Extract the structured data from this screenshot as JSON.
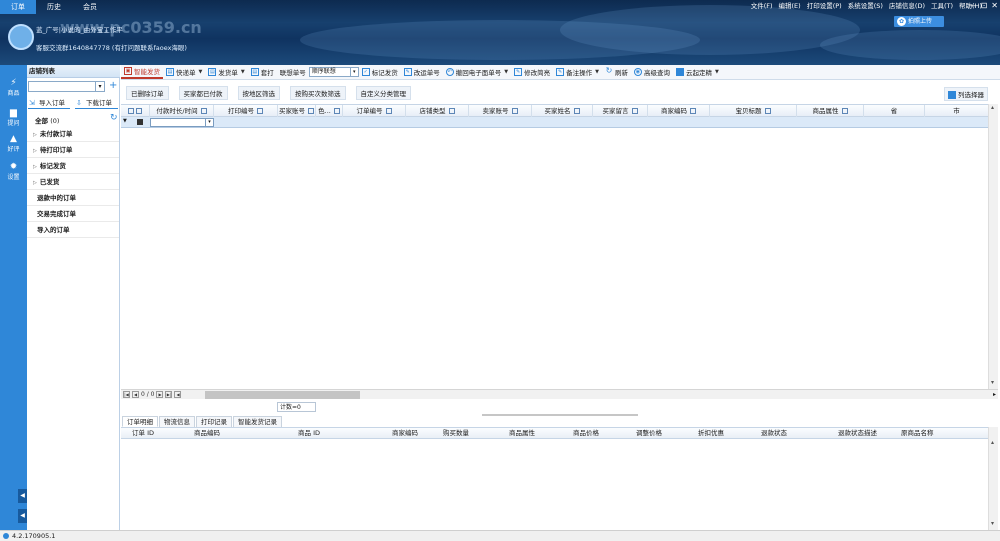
{
  "topnav": {
    "tabs": [
      "订单",
      "历史",
      "会员"
    ],
    "active": 0
  },
  "menubar": {
    "items": [
      "文件(F)",
      "编辑(E)",
      "打印设置(P)",
      "系统设置(S)",
      "店铺信息(D)",
      "工具(T)",
      "帮助(H)"
    ]
  },
  "window_controls": [
    "—",
    "⊡",
    "✕"
  ],
  "header": {
    "shop_line": "蓝_广号|小说的_由外宝工作平",
    "hotline": "客服交流群1640847778 (有打问题联系faoex海眼)",
    "upload_label": "拍照上传",
    "watermark": "www.pc0359.cn"
  },
  "left_strip": {
    "items": [
      {
        "icon": "share-icon",
        "label": "商品"
      },
      {
        "icon": "chat-icon",
        "label": "提问"
      },
      {
        "icon": "thumb-icon",
        "label": "好评"
      },
      {
        "icon": "gear-icon",
        "label": "设置"
      }
    ],
    "arrows": [
      "◀",
      "◀"
    ]
  },
  "sidebar": {
    "title": "店铺列表",
    "import_label": "导入订单",
    "download_label": "下载订单",
    "all_label": "全部",
    "all_count": "(0)",
    "rows": [
      {
        "label": "未付款订单",
        "expandable": true
      },
      {
        "label": "待打印订单",
        "expandable": true
      },
      {
        "label": "标记发货",
        "expandable": true
      },
      {
        "label": "已发货",
        "expandable": true
      },
      {
        "label": "退款中的订单",
        "expandable": false
      },
      {
        "label": "交易完成订单",
        "expandable": false
      },
      {
        "label": "导入的订单",
        "expandable": false
      }
    ]
  },
  "toolbar1": {
    "smart_ship": "智能发货",
    "express": "快递单",
    "ship": "发货单",
    "template": "套打",
    "link_label": "联想单号",
    "link_value": "顺序联想",
    "mark_ship": "标记发货",
    "change_express": "改运单号",
    "recycle": "撤回电子面单号",
    "modify": "修改简亮",
    "remark": "备注操作",
    "refresh": "刷新",
    "adv_query": "高级查询",
    "cloud_print": "云起定精"
  },
  "toolbar2": {
    "buttons": [
      "已删除订单",
      "买家都已付款",
      "按地区筛选",
      "按购买次数筛选",
      "自定义分类管理"
    ],
    "column_selector": "列选择器"
  },
  "grid": {
    "columns": [
      "付款时长/时间",
      "打印编号",
      "买家账号",
      "色...",
      "订单编号",
      "店铺类型",
      "卖家账号",
      "买家姓名",
      "买家留言",
      "商家编码",
      "宝贝标题",
      "商品属性",
      "省",
      "市"
    ]
  },
  "pager": {
    "page_info": "0 / 0",
    "count": "计数=0"
  },
  "bottom_tabs": [
    "订单明细",
    "物流信息",
    "打印记录",
    "智能发货记录"
  ],
  "detail": {
    "columns": [
      "订单 ID",
      "商品编码",
      "商品 ID",
      "商家编码",
      "购买数量",
      "商品属性",
      "商品价格",
      "调整价格",
      "折扣优惠",
      "退款状态",
      "退款状态描述",
      "原商品名称"
    ]
  },
  "status": {
    "version": "4.2.170905.1"
  }
}
